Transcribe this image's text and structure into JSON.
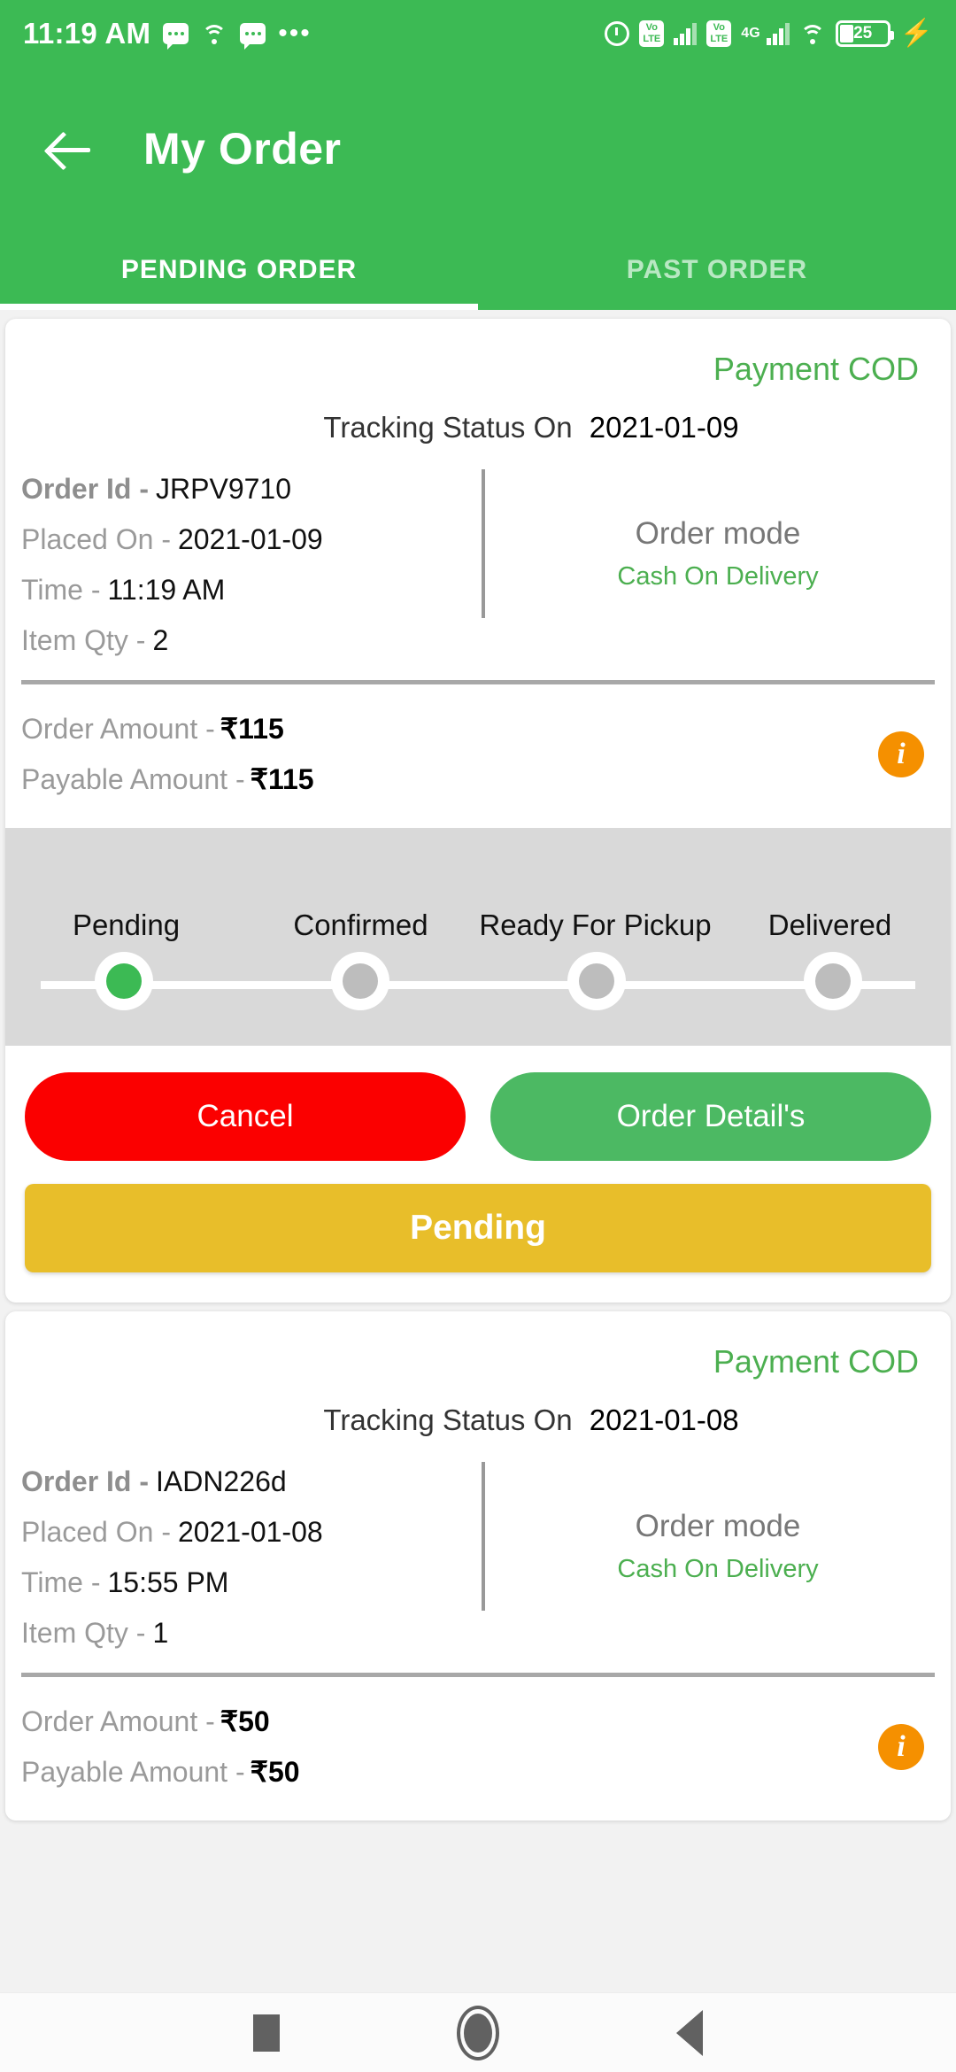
{
  "statusbar": {
    "time": "11:19 AM",
    "battery_percent": "25",
    "volte_label": "VoLTE",
    "network_label": "4G",
    "overflow": "•••"
  },
  "appbar": {
    "title": "My Order",
    "back_icon": "arrow-left-icon"
  },
  "tabs": [
    {
      "label": "PENDING ORDER",
      "active": true
    },
    {
      "label": "PAST ORDER",
      "active": false
    }
  ],
  "labels": {
    "payment": "Payment COD",
    "tracking_prefix": "Tracking Status On",
    "order_id": "Order Id -",
    "placed_on": "Placed On -",
    "time": "Time -",
    "item_qty": "Item Qty -",
    "order_mode": "Order mode",
    "order_amount": "Order Amount -",
    "payable_amount": "Payable Amount -",
    "cancel": "Cancel",
    "order_detail": "Order Detail's",
    "info_icon": "i"
  },
  "steps": [
    "Pending",
    "Confirmed",
    "Ready For Pickup",
    "Delivered"
  ],
  "colors": {
    "brand_green": "#3cba54",
    "accent_green": "#4caf50",
    "cancel_red": "#fb0000",
    "status_yellow": "#e8be2a",
    "info_orange": "#f59000",
    "stepper_bg": "#d9d9d9"
  },
  "orders": [
    {
      "payment": "Payment COD",
      "tracking_date": "2021-01-09",
      "order_id": "JRPV9710",
      "placed_on": "2021-01-09",
      "time": "11:19 AM",
      "item_qty": "2",
      "order_mode_value": "Cash On Delivery",
      "order_amount": "₹115",
      "payable_amount": "₹115",
      "current_step": 0,
      "status_label": "Pending"
    },
    {
      "payment": "Payment COD",
      "tracking_date": "2021-01-08",
      "order_id": "IADN226d",
      "placed_on": "2021-01-08",
      "time": "15:55 PM",
      "item_qty": "1",
      "order_mode_value": "Cash On Delivery",
      "order_amount": "₹50",
      "payable_amount": "₹50"
    }
  ],
  "navbar": {
    "recents": "square-icon",
    "home": "circle-icon",
    "back": "triangle-back-icon"
  }
}
